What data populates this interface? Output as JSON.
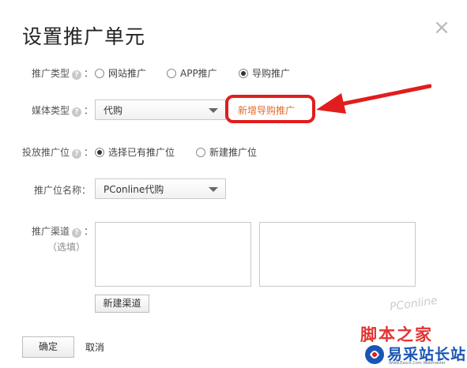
{
  "dialog": {
    "title": "设置推广单元",
    "close_glyph": "×"
  },
  "promo_type": {
    "label": "推广类型",
    "options": [
      {
        "label": "网站推广",
        "checked": false
      },
      {
        "label": "APP推广",
        "checked": false
      },
      {
        "label": "导购推广",
        "checked": true
      }
    ]
  },
  "media_type": {
    "label": "媒体类型",
    "selected": "代购",
    "add_link": "新增导购推广"
  },
  "placement": {
    "label": "投放推广位",
    "options": [
      {
        "label": "选择已有推广位",
        "checked": true
      },
      {
        "label": "新建推广位",
        "checked": false
      }
    ]
  },
  "placement_name": {
    "label": "推广位名称：",
    "selected": "PConline代购"
  },
  "channel": {
    "label": "推广渠道",
    "optional_hint": "（选填）",
    "new_button": "新建渠道"
  },
  "footer": {
    "confirm": "确定",
    "cancel": "取消"
  },
  "help_glyph": "?",
  "colon": "：",
  "watermark": {
    "text_cn": "脚本之家",
    "text_en": "PConline",
    "brand": "易采站长站",
    "brand_sub": "Www.Easck.Com Webmaster"
  },
  "colors": {
    "highlight": "#e21d1d",
    "link": "#e06a2b",
    "brand_blue": "#1a55b5"
  },
  "icons": [
    "close-icon",
    "help-icon",
    "caret-down-icon",
    "red-arrow-icon",
    "logo-icon"
  ]
}
